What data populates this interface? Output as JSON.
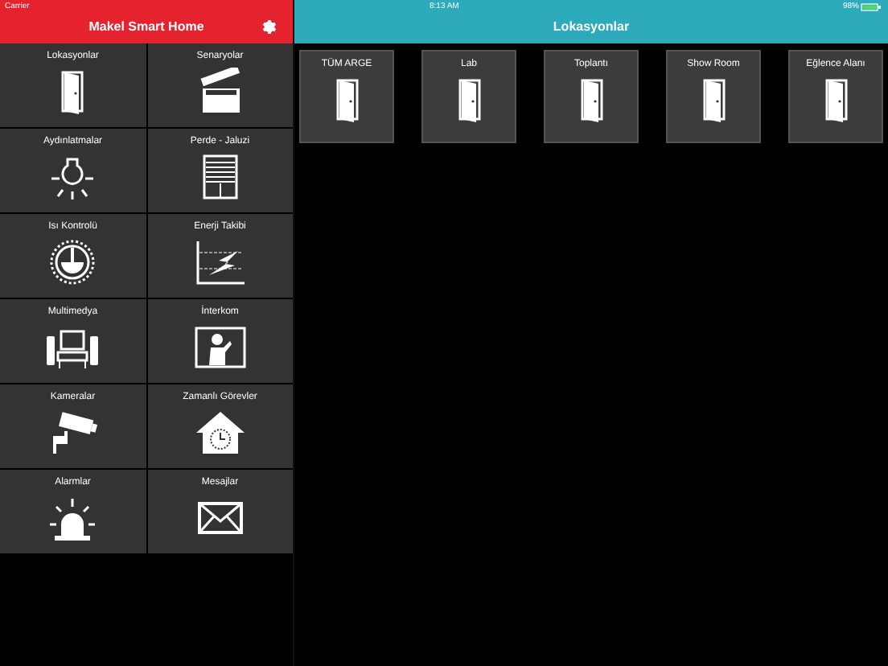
{
  "status_bar": {
    "carrier": "Carrier",
    "time": "8:13 AM",
    "battery": "98%"
  },
  "sidebar": {
    "title": "Makel Smart Home",
    "items": [
      {
        "label": "Lokasyonlar",
        "kind": "door"
      },
      {
        "label": "Senaryolar",
        "kind": "clapper"
      },
      {
        "label": "Aydınlatmalar",
        "kind": "bulb"
      },
      {
        "label": "Perde - Jaluzi",
        "kind": "blind"
      },
      {
        "label": "Isı Kontrolü",
        "kind": "gauge"
      },
      {
        "label": "Enerji Takibi",
        "kind": "energy"
      },
      {
        "label": "Multimedya",
        "kind": "media"
      },
      {
        "label": "İnterkom",
        "kind": "intercom"
      },
      {
        "label": "Kameralar",
        "kind": "camera"
      },
      {
        "label": "Zamanlı Görevler",
        "kind": "house"
      },
      {
        "label": "Alarmlar",
        "kind": "alarm"
      },
      {
        "label": "Mesajlar",
        "kind": "mail"
      }
    ]
  },
  "main": {
    "title": "Lokasyonlar",
    "locations": [
      {
        "label": "TÜM ARGE"
      },
      {
        "label": "Lab"
      },
      {
        "label": "Toplantı"
      },
      {
        "label": "Show Room"
      },
      {
        "label": "Eğlence Alanı"
      }
    ]
  }
}
